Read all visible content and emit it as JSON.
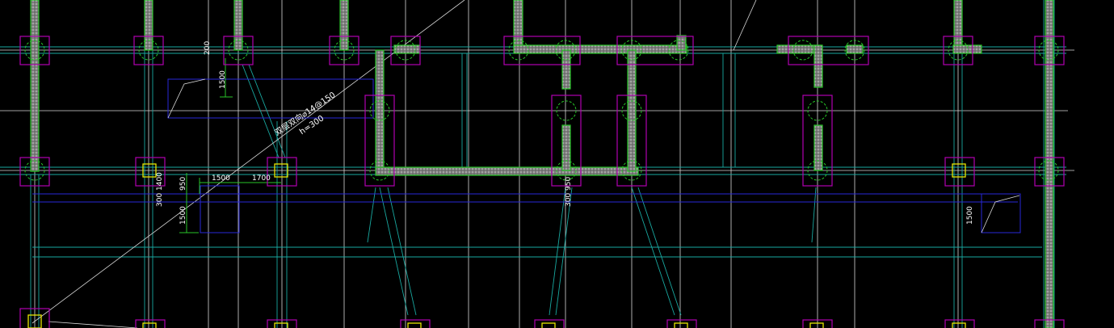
{
  "drawing": {
    "colors": {
      "background": "#000000",
      "grid_white": "#d8d8d8",
      "grid_cyan": "#19a8a0",
      "pile_cap": "#b000b0",
      "wall_fill": "#9a9a9a",
      "wall_edge": "#27c427",
      "column_yellow": "#e6e600",
      "beam_blue": "#2828d8"
    },
    "annotations": {
      "slab_reinforcement": "双层双向⌀14@150",
      "slab_thickness": "h=300"
    },
    "dimensions": {
      "d200": "200",
      "d1500_top": "1500",
      "d300_left": "300",
      "d1400": "1400",
      "d950_left": "950",
      "d1500_horiz": "1500",
      "d1700": "1700",
      "d1500_left_lower": "1500",
      "d300_mid": "300",
      "d950_mid": "950",
      "d1500_right": "1500"
    }
  }
}
